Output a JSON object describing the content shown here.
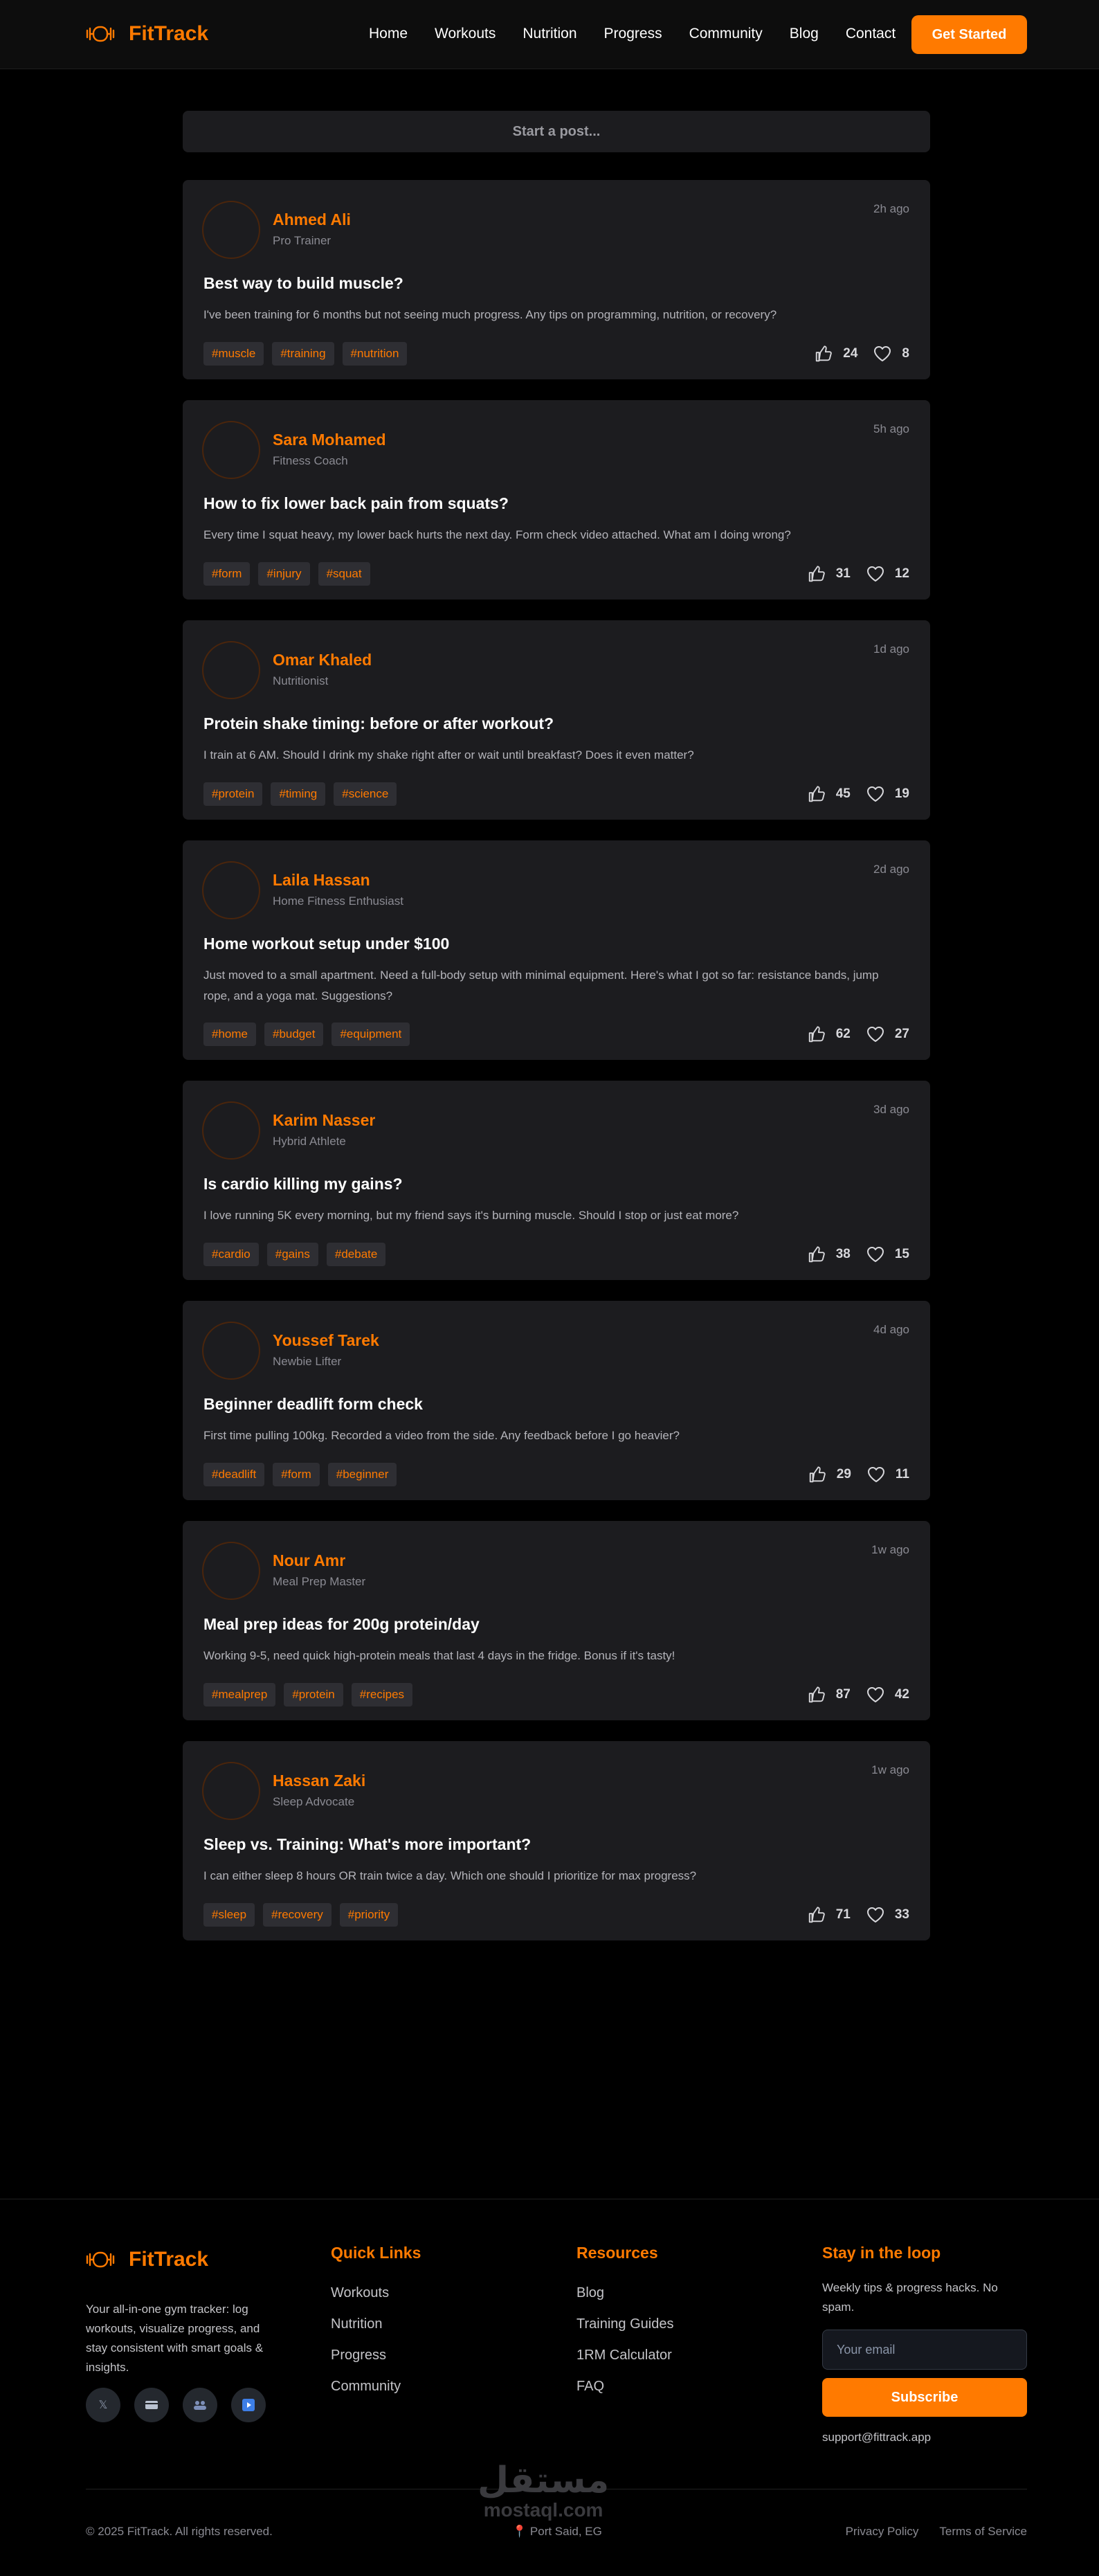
{
  "header": {
    "brand": "FitTrack",
    "nav": [
      "Home",
      "Workouts",
      "Nutrition",
      "Progress",
      "Community",
      "Blog",
      "Contact"
    ],
    "cta": "Get Started"
  },
  "composer": {
    "label": "Start a post..."
  },
  "posts": [
    {
      "author": "Ahmed Ali",
      "role": "Pro Trainer",
      "time": "2h ago",
      "title": "Best way to build muscle?",
      "body": "I've been training for 6 months but not seeing much progress. Any tips on programming, nutrition, or recovery?",
      "tags": [
        "#muscle",
        "#training",
        "#nutrition"
      ],
      "likes": "24",
      "hearts": "8"
    },
    {
      "author": "Sara Mohamed",
      "role": "Fitness Coach",
      "time": "5h ago",
      "title": "How to fix lower back pain from squats?",
      "body": "Every time I squat heavy, my lower back hurts the next day. Form check video attached. What am I doing wrong?",
      "tags": [
        "#form",
        "#injury",
        "#squat"
      ],
      "likes": "31",
      "hearts": "12"
    },
    {
      "author": "Omar Khaled",
      "role": "Nutritionist",
      "time": "1d ago",
      "title": "Protein shake timing: before or after workout?",
      "body": "I train at 6 AM. Should I drink my shake right after or wait until breakfast? Does it even matter?",
      "tags": [
        "#protein",
        "#timing",
        "#science"
      ],
      "likes": "45",
      "hearts": "19"
    },
    {
      "author": "Laila Hassan",
      "role": "Home Fitness Enthusiast",
      "time": "2d ago",
      "title": "Home workout setup under $100",
      "body": "Just moved to a small apartment. Need a full-body setup with minimal equipment. Here's what I got so far: resistance bands, jump rope, and a yoga mat. Suggestions?",
      "tags": [
        "#home",
        "#budget",
        "#equipment"
      ],
      "likes": "62",
      "hearts": "27"
    },
    {
      "author": "Karim Nasser",
      "role": "Hybrid Athlete",
      "time": "3d ago",
      "title": "Is cardio killing my gains?",
      "body": "I love running 5K every morning, but my friend says it's burning muscle. Should I stop or just eat more?",
      "tags": [
        "#cardio",
        "#gains",
        "#debate"
      ],
      "likes": "38",
      "hearts": "15"
    },
    {
      "author": "Youssef Tarek",
      "role": "Newbie Lifter",
      "time": "4d ago",
      "title": "Beginner deadlift form check",
      "body": "First time pulling 100kg. Recorded a video from the side. Any feedback before I go heavier?",
      "tags": [
        "#deadlift",
        "#form",
        "#beginner"
      ],
      "likes": "29",
      "hearts": "11"
    },
    {
      "author": "Nour Amr",
      "role": "Meal Prep Master",
      "time": "1w ago",
      "title": "Meal prep ideas for 200g protein/day",
      "body": "Working 9-5, need quick high-protein meals that last 4 days in the fridge. Bonus if it's tasty!",
      "tags": [
        "#mealprep",
        "#protein",
        "#recipes"
      ],
      "likes": "87",
      "hearts": "42"
    },
    {
      "author": "Hassan Zaki",
      "role": "Sleep Advocate",
      "time": "1w ago",
      "title": "Sleep vs. Training: What's more important?",
      "body": "I can either sleep 8 hours OR train twice a day. Which one should I prioritize for max progress?",
      "tags": [
        "#sleep",
        "#recovery",
        "#priority"
      ],
      "likes": "71",
      "hearts": "33"
    }
  ],
  "footer": {
    "brand": "FitTrack",
    "description": "Your all-in-one gym tracker: log workouts, visualize progress, and stay consistent with smart goals & insights.",
    "socials": [
      "x-icon",
      "card-icon",
      "community-icon",
      "play-icon"
    ],
    "quick_links": {
      "heading": "Quick Links",
      "items": [
        "Workouts",
        "Nutrition",
        "Progress",
        "Community"
      ]
    },
    "resources": {
      "heading": "Resources",
      "items": [
        "Blog",
        "Training Guides",
        "1RM Calculator",
        "FAQ"
      ]
    },
    "newsletter": {
      "heading": "Stay in the loop",
      "text": "Weekly tips & progress hacks. No spam.",
      "placeholder": "Your email",
      "button": "Subscribe",
      "support": "support@fittrack.app"
    },
    "copyright": "© 2025 FitTrack. All rights reserved.",
    "location": "Port Said, EG",
    "legal": [
      "Privacy Policy",
      "Terms of Service"
    ]
  },
  "watermark": {
    "arabic": "مستقل",
    "latin": "mostaql.com"
  },
  "colors": {
    "accent": "#ff7a00",
    "card": "#1c1c1f",
    "tag_bg": "#2e2e33",
    "background": "#000000"
  }
}
